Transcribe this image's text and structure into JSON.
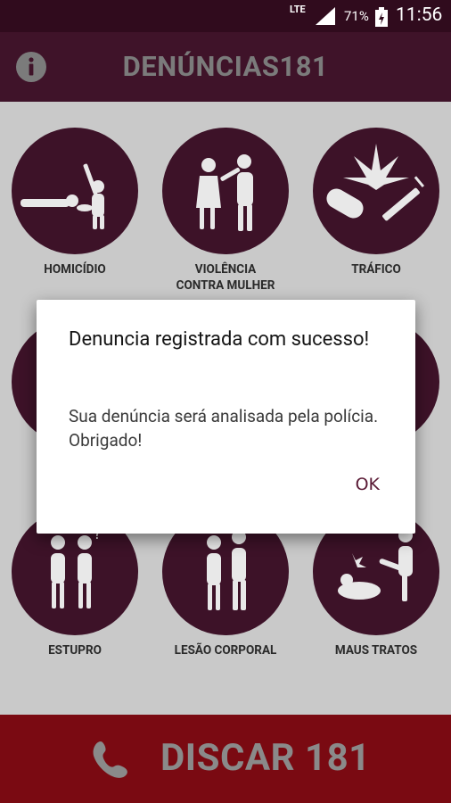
{
  "status_bar": {
    "network": "LTE",
    "battery_percent": "71%",
    "time": "11:56"
  },
  "app_bar": {
    "title": "DENÚNCIAS181",
    "info_icon": "info-icon"
  },
  "categories": [
    {
      "label": "HOMICÍDIO",
      "icon": "homicide-icon"
    },
    {
      "label": "VIOLÊNCIA\nCONTRA MULHER",
      "icon": "violence-against-woman-icon"
    },
    {
      "label": "TRÁFICO",
      "icon": "drug-trafficking-icon"
    },
    {
      "label": "ESTUPRO",
      "icon": "rape-icon"
    },
    {
      "label": "LESÃO CORPORAL",
      "icon": "bodily-injury-icon"
    },
    {
      "label": "MAUS TRATOS",
      "icon": "mistreatment-icon"
    }
  ],
  "dialog": {
    "title": "Denuncia registrada com sucesso!",
    "message": "Sua denúncia será analisada pela polícia. Obrigado!",
    "ok_label": "OK"
  },
  "dial_bar": {
    "label": "DISCAR 181",
    "icon": "phone-icon"
  },
  "colors": {
    "status_bar": "#300b1d",
    "app_bar": "#3f1329",
    "circle": "#3d1228",
    "dial_bar": "#7a0a12",
    "background": "#c9c9c9"
  }
}
